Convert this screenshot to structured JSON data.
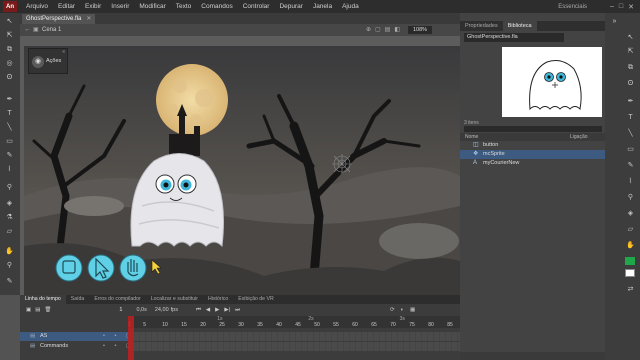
{
  "app": {
    "logo": "An"
  },
  "menu": [
    "Arquivo",
    "Editar",
    "Exibir",
    "Inserir",
    "Modificar",
    "Texto",
    "Comandos",
    "Controlar",
    "Depurar",
    "Janela",
    "Ajuda"
  ],
  "workspace": "Essenciais",
  "document": {
    "tab": "GhostPerspective.fla"
  },
  "scene": {
    "name": "Cena 1",
    "zoom": "108%"
  },
  "actions_panel": {
    "label": "Ações"
  },
  "right_panel": {
    "tabs": [
      "Propriedades",
      "Biblioteca"
    ],
    "active_tab": "Biblioteca",
    "file": "GhostPerspective.fla",
    "count": "3 itens",
    "columns": [
      "Nome",
      "Ligação"
    ],
    "items": [
      {
        "name": "button",
        "icon": "button-symbol-icon",
        "selected": false
      },
      {
        "name": "mcSprite",
        "icon": "movieclip-icon",
        "selected": true
      },
      {
        "name": "myCourierNew",
        "icon": "font-icon",
        "selected": false
      }
    ]
  },
  "timeline": {
    "tabs": [
      "Linha do tempo",
      "Saída",
      "Erros do compilador",
      "Localizar e substituir",
      "Histórico",
      "Exibição de VR"
    ],
    "active_tab": "Linha do tempo",
    "frame": "1",
    "time": "0,0s",
    "fps": "24,00",
    "fps_unit": "fps",
    "seconds": [
      "1s",
      "2s",
      "3s"
    ],
    "frame_numbers": [
      "1",
      "5",
      "10",
      "15",
      "20",
      "25",
      "30",
      "35",
      "40",
      "45",
      "50",
      "55",
      "60",
      "65",
      "70",
      "75",
      "80",
      "85"
    ],
    "layers": [
      {
        "name": "AS",
        "selected": true
      },
      {
        "name": "Commands",
        "selected": false
      }
    ]
  },
  "colors": {
    "menubar": "#2d2d2d",
    "panel": "#434343",
    "selection": "#3d5a80",
    "playhead": "#c02020",
    "moon": "#e8c98a",
    "ghost_eye": "#3fb6d8",
    "button_fill": "#5fd0e6"
  }
}
